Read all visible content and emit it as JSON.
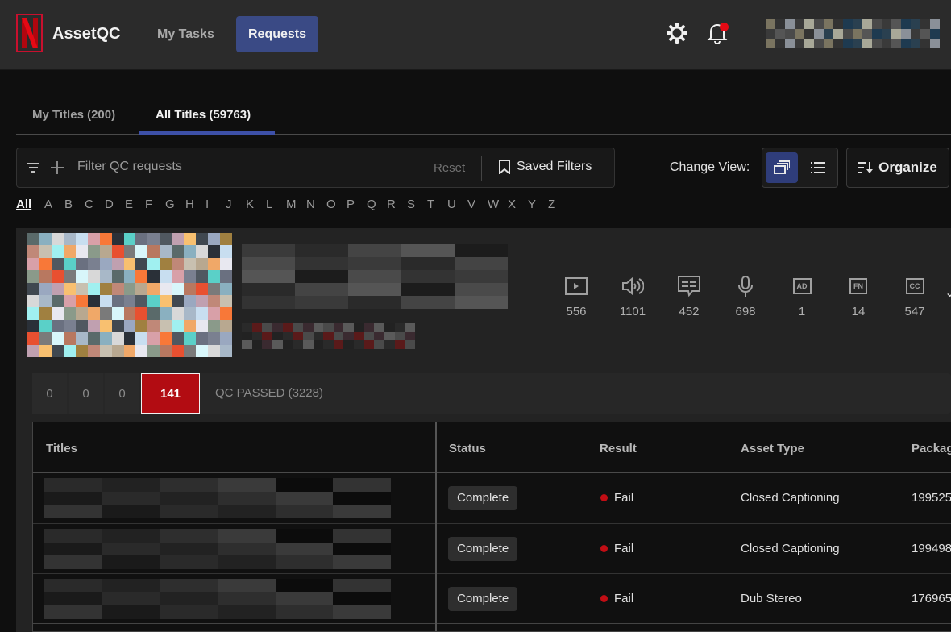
{
  "header": {
    "app_title": "AssetQC",
    "nav": [
      {
        "label": "My Tasks",
        "active": false
      },
      {
        "label": "Requests",
        "active": true
      }
    ],
    "icons": [
      "gear-icon",
      "bell-icon"
    ],
    "notification_dot_color": "#e50914"
  },
  "tabs": [
    {
      "label": "My Titles (200)",
      "active": false
    },
    {
      "label": "All Titles (59763)",
      "active": true
    }
  ],
  "filter": {
    "placeholder": "Filter QC requests",
    "value": "",
    "reset_label": "Reset",
    "saved_filters_label": "Saved Filters"
  },
  "view": {
    "change_view_label": "Change View:",
    "options": [
      "card-view",
      "list-view"
    ],
    "active": "card-view",
    "organize_label": "Organize"
  },
  "alphabet": [
    "All",
    "A",
    "B",
    "C",
    "D",
    "E",
    "F",
    "G",
    "H",
    "I",
    "J",
    "K",
    "L",
    "M",
    "N",
    "O",
    "P",
    "Q",
    "R",
    "S",
    "T",
    "U",
    "V",
    "W",
    "X",
    "Y",
    "Z"
  ],
  "alphabet_active": "All",
  "title_card": {
    "stats": [
      {
        "icon": "video-icon",
        "value": "556"
      },
      {
        "icon": "audio-icon",
        "value": "1101"
      },
      {
        "icon": "subtitle-icon",
        "value": "452"
      },
      {
        "icon": "microphone-icon",
        "value": "698"
      },
      {
        "icon": "audio-description-icon",
        "label": "AD",
        "value": "1"
      },
      {
        "icon": "forced-narrative-icon",
        "label": "FN",
        "value": "14"
      },
      {
        "icon": "closed-caption-icon",
        "label": "CC",
        "value": "547"
      }
    ],
    "status_strip": {
      "counts": [
        "0",
        "0",
        "0"
      ],
      "active_count": "141",
      "passed_label": "QC PASSED (3228)"
    },
    "table": {
      "columns": [
        "Titles",
        "Status",
        "Result",
        "Asset Type",
        "Packag"
      ],
      "rows": [
        {
          "status": "Complete",
          "result": "Fail",
          "asset_type": "Closed Captioning",
          "package": "199525"
        },
        {
          "status": "Complete",
          "result": "Fail",
          "asset_type": "Closed Captioning",
          "package": "199498"
        },
        {
          "status": "Complete",
          "result": "Fail",
          "asset_type": "Dub Stereo",
          "package": "176965"
        }
      ]
    }
  },
  "colors": {
    "accent": "#3a4a85",
    "fail": "#c10d14",
    "active_count_bg": "#b20c12",
    "brand_red": "#e50914"
  }
}
